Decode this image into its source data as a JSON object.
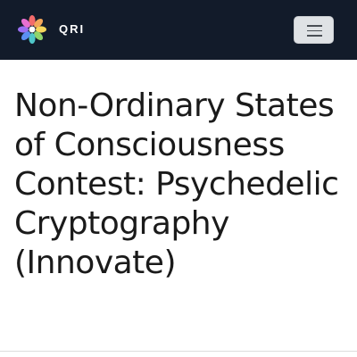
{
  "header": {
    "brand": "QRI",
    "logo_icon": "flower-logo-icon",
    "menu_icon": "hamburger-menu-icon",
    "background": "#121b2a"
  },
  "main": {
    "title": "Non-Ordinary States of Consciousness Contest: Psychedelic Cryptography (Innovate)"
  }
}
